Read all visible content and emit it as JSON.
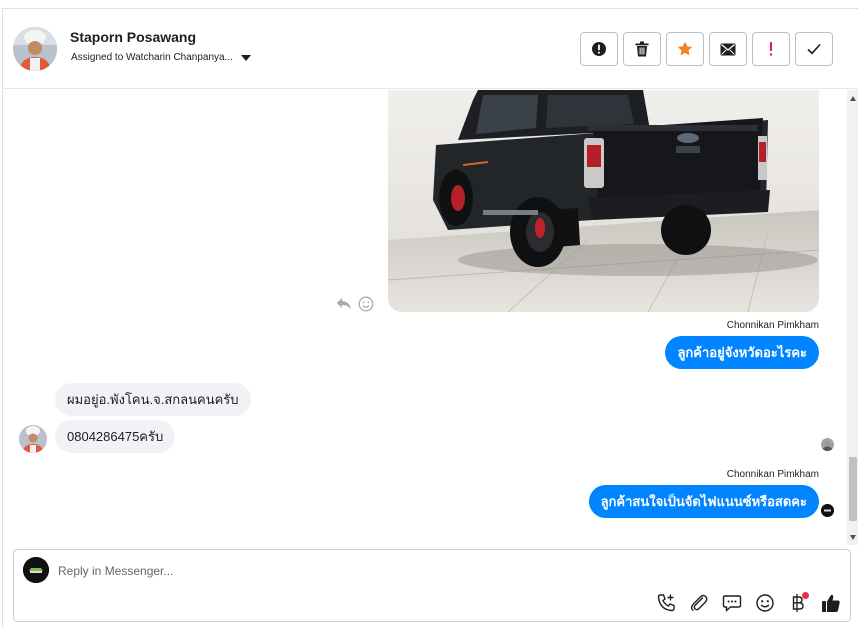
{
  "header": {
    "contact_name": "Staporn Posawang",
    "assigned_text": "Assigned to Watcharin Chanpanya...",
    "actions": [
      {
        "name": "report-spam-button",
        "icon": "alert-circle-icon"
      },
      {
        "name": "delete-button",
        "icon": "trash-icon"
      },
      {
        "name": "star-button",
        "icon": "star-icon",
        "color": "#f5821f"
      },
      {
        "name": "mark-unread-button",
        "icon": "envelope-icon"
      },
      {
        "name": "mark-important-button",
        "icon": "exclamation-icon",
        "color": "#e41e3f"
      },
      {
        "name": "mark-done-button",
        "icon": "check-icon"
      }
    ]
  },
  "messages": {
    "photo_alt_icon": "pickup-truck-photo",
    "sender_1": "Chonnikan Pimkham",
    "out_1": "ลูกค้าอยู่จังหวัดอะไรคะ",
    "in_1": "ผมอยู่อ.พังโคน.จ.สกลนคนครับ",
    "in_2": "0804286475ครับ",
    "sender_2": "Chonnikan Pimkham",
    "out_2": "ลูกค้าสนใจเป็นจัดไฟแนนซ์หรือสดคะ"
  },
  "composer": {
    "placeholder": "Reply in Messenger..."
  },
  "colors": {
    "messenger_blue": "#0084ff",
    "incoming_bg": "#f0f2f5",
    "star": "#f5821f",
    "important": "#e41e3f",
    "thumbs_up": "#1c1e21"
  }
}
